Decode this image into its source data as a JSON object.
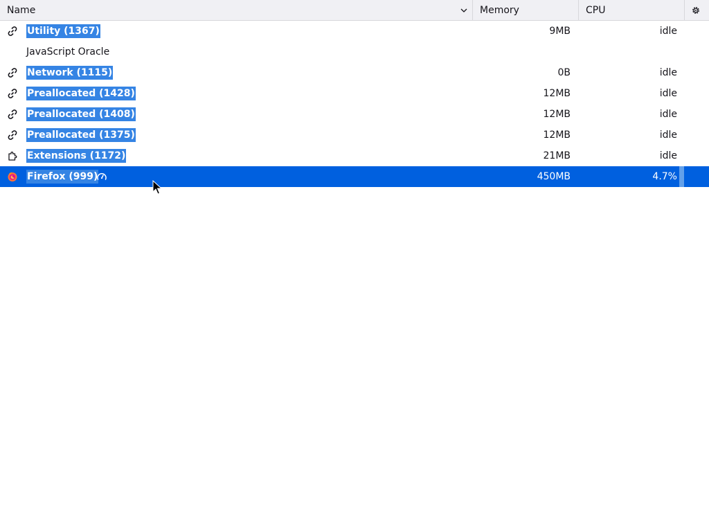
{
  "header": {
    "name_label": "Name",
    "memory_label": "Memory",
    "cpu_label": "CPU",
    "sort_icon": "chevron-down-icon",
    "settings_icon": "gear-icon"
  },
  "rows": [
    {
      "name": "Utility (1367)",
      "icon": "link-icon",
      "memory": "9MB",
      "cpu": "idle",
      "highlighted": true
    },
    {
      "name": "JavaScript Oracle",
      "icon": "",
      "memory": "",
      "cpu": "",
      "highlighted": false
    },
    {
      "name": "Network (1115)",
      "icon": "link-icon",
      "memory": "0B",
      "cpu": "idle",
      "highlighted": true
    },
    {
      "name": "Preallocated (1428)",
      "icon": "link-icon",
      "memory": "12MB",
      "cpu": "idle",
      "highlighted": true
    },
    {
      "name": "Preallocated (1408)",
      "icon": "link-icon",
      "memory": "12MB",
      "cpu": "idle",
      "highlighted": true
    },
    {
      "name": "Preallocated (1375)",
      "icon": "link-icon",
      "memory": "12MB",
      "cpu": "idle",
      "highlighted": true
    },
    {
      "name": "Extensions (1172)",
      "icon": "puzzle-piece-icon",
      "memory": "21MB",
      "cpu": "idle",
      "highlighted": true
    },
    {
      "name": "Firefox (999)",
      "icon": "firefox-logo-icon",
      "memory": "450MB",
      "cpu": "4.7%",
      "highlighted": true,
      "selected": true,
      "extra_icon": "profiler-gauge-icon",
      "cpu_fraction": 0.047
    }
  ],
  "colors": {
    "selection": "#0060df",
    "text_highlight": "#3584e4",
    "cpu_bar": "#62a0ea",
    "header_bg": "#f0f0f4"
  }
}
